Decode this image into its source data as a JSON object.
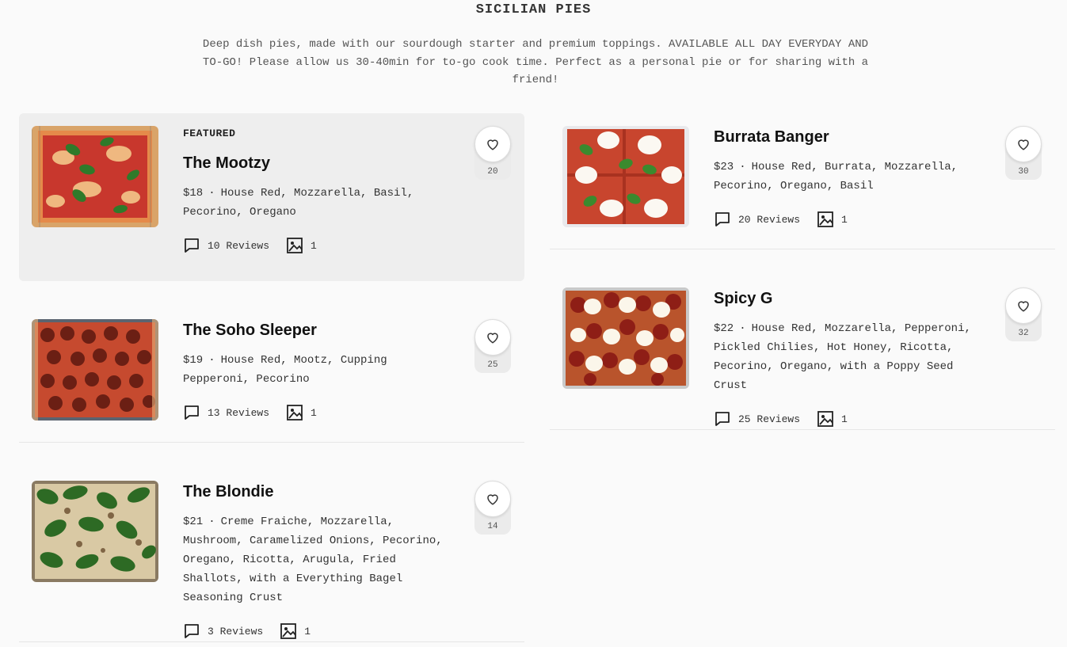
{
  "section": {
    "title": "SICILIAN PIES",
    "description": "Deep dish pies, made with our sourdough starter and premium toppings. AVAILABLE ALL DAY EVERYDAY AND TO-GO! Please allow us 30-40min for to-go cook time. Perfect as a personal pie or for sharing with a friend!"
  },
  "items": [
    {
      "badge": "FEATURED",
      "name": "The Mootzy",
      "price": "$18",
      "separator": "·",
      "ingredients": "House Red, Mozzarella, Basil, Pecorino, Oregano",
      "reviews": "10 Reviews",
      "photos": "1",
      "likes": "20"
    },
    {
      "badge": "",
      "name": "The Soho Sleeper",
      "price": "$19",
      "separator": "·",
      "ingredients": "House Red, Mootz, Cupping Pepperoni, Pecorino",
      "reviews": "13 Reviews",
      "photos": "1",
      "likes": "25"
    },
    {
      "badge": "",
      "name": "The Blondie",
      "price": "$21",
      "separator": "·",
      "ingredients": "Creme Fraiche, Mozzarella, Mushroom, Caramelized Onions, Pecorino, Oregano, Ricotta, Arugula, Fried Shallots, with a Everything Bagel Seasoning Crust",
      "reviews": "3 Reviews",
      "photos": "1",
      "likes": "14"
    },
    {
      "badge": "",
      "name": "Burrata Banger",
      "price": "$23",
      "separator": "·",
      "ingredients": "House Red, Burrata, Mozzarella, Pecorino, Oregano, Basil",
      "reviews": "20 Reviews",
      "photos": "1",
      "likes": "30"
    },
    {
      "badge": "",
      "name": "Spicy G",
      "price": "$22",
      "separator": "·",
      "ingredients": "House Red, Mozzarella, Pepperoni, Pickled Chilies, Hot Honey, Ricotta, Pecorino, Oregano, with a Poppy Seed Crust",
      "reviews": "25 Reviews",
      "photos": "1",
      "likes": "32"
    }
  ],
  "icons": {
    "review": "speech-bubble-icon",
    "photo": "image-icon",
    "favorite": "heart-icon"
  },
  "colors": {
    "background": "#fafafa",
    "featured_bg": "#eeeeee",
    "sauce": "#c8372d",
    "basil": "#2f7a2a"
  }
}
